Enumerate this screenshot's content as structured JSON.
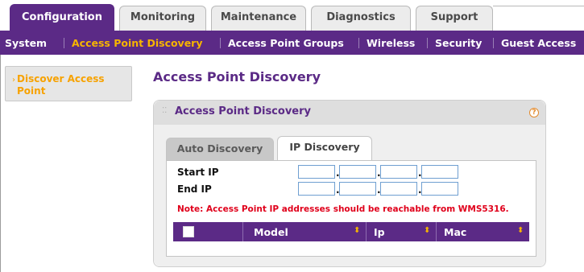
{
  "top_tabs": [
    "Configuration",
    "Monitoring",
    "Maintenance",
    "Diagnostics",
    "Support"
  ],
  "subnav": [
    "System",
    "Access Point Discovery",
    "Access Point Groups",
    "Wireless",
    "Security",
    "Guest Access"
  ],
  "sidebar": {
    "arrow": "›",
    "item": "Discover Access Point"
  },
  "page_title": "Access Point Discovery",
  "panel": {
    "title": "Access Point Discovery",
    "help": "?",
    "tabs": [
      "Auto Discovery",
      "IP Discovery"
    ],
    "start_ip_label": "Start IP",
    "end_ip_label": "End IP",
    "dot": ".",
    "note": "Note: Access Point IP addresses should be reachable from WMS5316.",
    "table_headers": [
      "Model",
      "Ip",
      "Mac"
    ],
    "sort_glyph": "⬍"
  },
  "colors": {
    "brand_purple": "#5b2a86",
    "accent_orange": "#f7b500",
    "note_red": "#e0001b"
  }
}
